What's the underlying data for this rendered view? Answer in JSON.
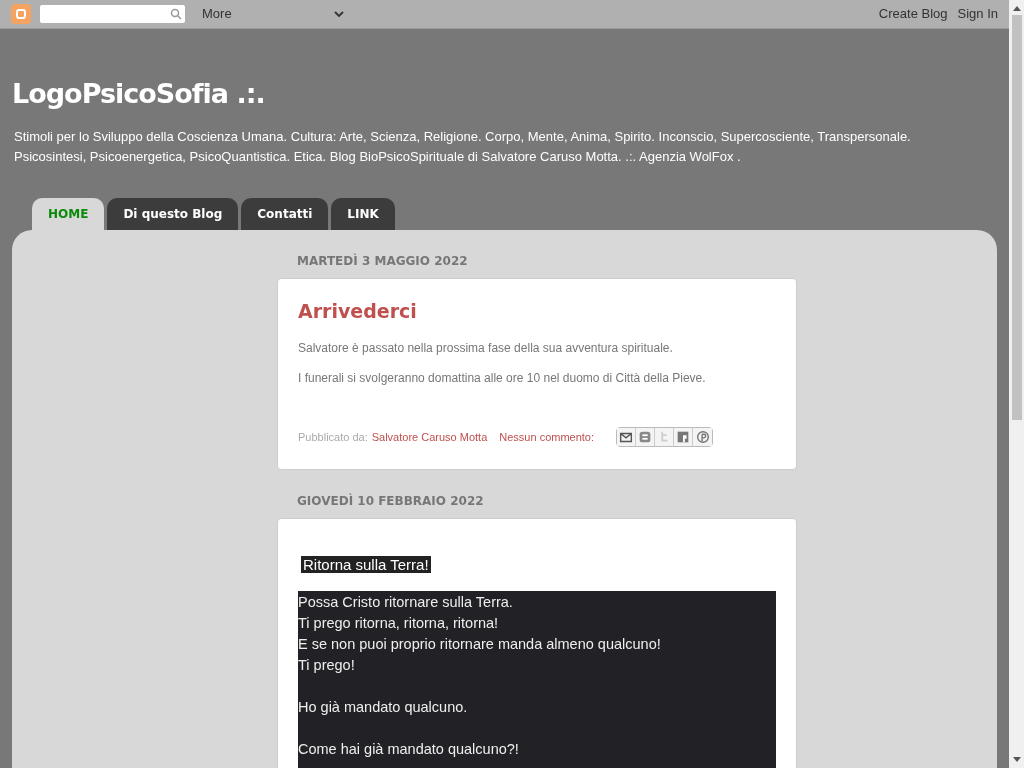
{
  "navbar": {
    "more": "More",
    "links": [
      "Create Blog",
      "Sign In"
    ]
  },
  "blog": {
    "title": "LogoPsicoSofia .:.",
    "description": "Stimoli per lo Sviluppo della Coscienza Umana. Cultura: Arte, Scienza, Religione. Corpo, Mente, Anima, Spirito. Inconscio, Supercosciente, Transpersonale. Psicosintesi, Psicoenergetica, PsicoQuantistica. Etica. Blog BioPsicoSpirituale di Salvatore Caruso Motta. .:. Agenzia WolFox ."
  },
  "tabs": [
    {
      "label": "HOME",
      "selected": true
    },
    {
      "label": "Di questo Blog",
      "selected": false
    },
    {
      "label": "Contatti",
      "selected": false
    },
    {
      "label": "LINK",
      "selected": false
    }
  ],
  "posts": [
    {
      "date": "MARTEDÌ 3 MAGGIO 2022",
      "title": "Arrivederci",
      "paragraphs": [
        "Salvatore è passato nella prossima fase della sua avventura spirituale.",
        "I funerali si svolgeranno domattina alle ore 10 nel duomo di Città della Pieve."
      ],
      "footer": {
        "posted_by_label": "Pubblicato da:",
        "author": "Salvatore Caruso Motta",
        "comments": "Nessun commento:"
      }
    },
    {
      "date": "GIOVEDÌ 10 FEBBRAIO 2022",
      "heading": "Ritorna sulla Terra!",
      "stanzas": [
        [
          "Possa Cristo ritornare sulla Terra.",
          "Ti prego ritorna, ritorna, ritorna!",
          "E se non puoi proprio ritornare manda almeno qualcuno!",
          "Ti prego!"
        ],
        [
          "Ho già mandato qualcuno."
        ],
        [
          "Come hai già mandato qualcuno?!"
        ]
      ]
    }
  ]
}
